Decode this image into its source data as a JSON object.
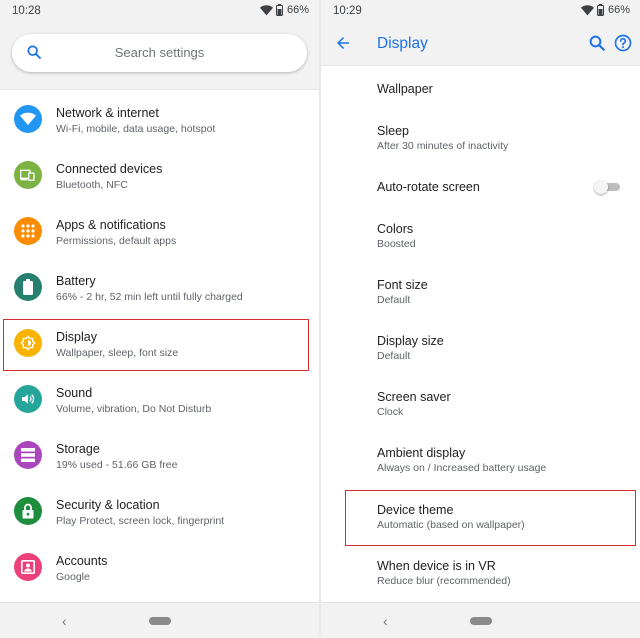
{
  "left": {
    "status": {
      "time": "10:28",
      "battery": "66%"
    },
    "search": {
      "placeholder": "Search settings"
    },
    "items": [
      {
        "title": "Network & internet",
        "subtitle": "Wi-Fi, mobile, data usage, hotspot",
        "icon": "wifi-icon",
        "color": "#2196f3"
      },
      {
        "title": "Connected devices",
        "subtitle": "Bluetooth, NFC",
        "icon": "devices-icon",
        "color": "#7cb342"
      },
      {
        "title": "Apps & notifications",
        "subtitle": "Permissions, default apps",
        "icon": "apps-icon",
        "color": "#fb8c00"
      },
      {
        "title": "Battery",
        "subtitle": "66% - 2 hr, 52 min left until fully charged",
        "icon": "battery-icon",
        "color": "#26806f"
      },
      {
        "title": "Display",
        "subtitle": "Wallpaper, sleep, font size",
        "icon": "brightness-icon",
        "color": "#f9b300"
      },
      {
        "title": "Sound",
        "subtitle": "Volume, vibration, Do Not Disturb",
        "icon": "volume-icon",
        "color": "#26a69a"
      },
      {
        "title": "Storage",
        "subtitle": "19% used - 51.66 GB free",
        "icon": "storage-icon",
        "color": "#ab47bc"
      },
      {
        "title": "Security & location",
        "subtitle": "Play Protect, screen lock, fingerprint",
        "icon": "lock-icon",
        "color": "#1e8e3e"
      },
      {
        "title": "Accounts",
        "subtitle": "Google",
        "icon": "account-icon",
        "color": "#ec407a"
      }
    ]
  },
  "right": {
    "status": {
      "time": "10:29",
      "battery": "66%"
    },
    "title": "Display",
    "items": [
      {
        "title": "Wallpaper",
        "subtitle": ""
      },
      {
        "title": "Sleep",
        "subtitle": "After 30 minutes of inactivity"
      },
      {
        "title": "Auto-rotate screen",
        "subtitle": "",
        "toggle": false
      },
      {
        "title": "Colors",
        "subtitle": "Boosted"
      },
      {
        "title": "Font size",
        "subtitle": "Default"
      },
      {
        "title": "Display size",
        "subtitle": "Default"
      },
      {
        "title": "Screen saver",
        "subtitle": "Clock"
      },
      {
        "title": "Ambient display",
        "subtitle": "Always on / Increased battery usage"
      },
      {
        "title": "Device theme",
        "subtitle": "Automatic (based on wallpaper)"
      },
      {
        "title": "When device is in VR",
        "subtitle": "Reduce blur (recommended)"
      }
    ]
  },
  "colors": {
    "accent": "#1a73e8",
    "highlight": "#d32f2f"
  }
}
